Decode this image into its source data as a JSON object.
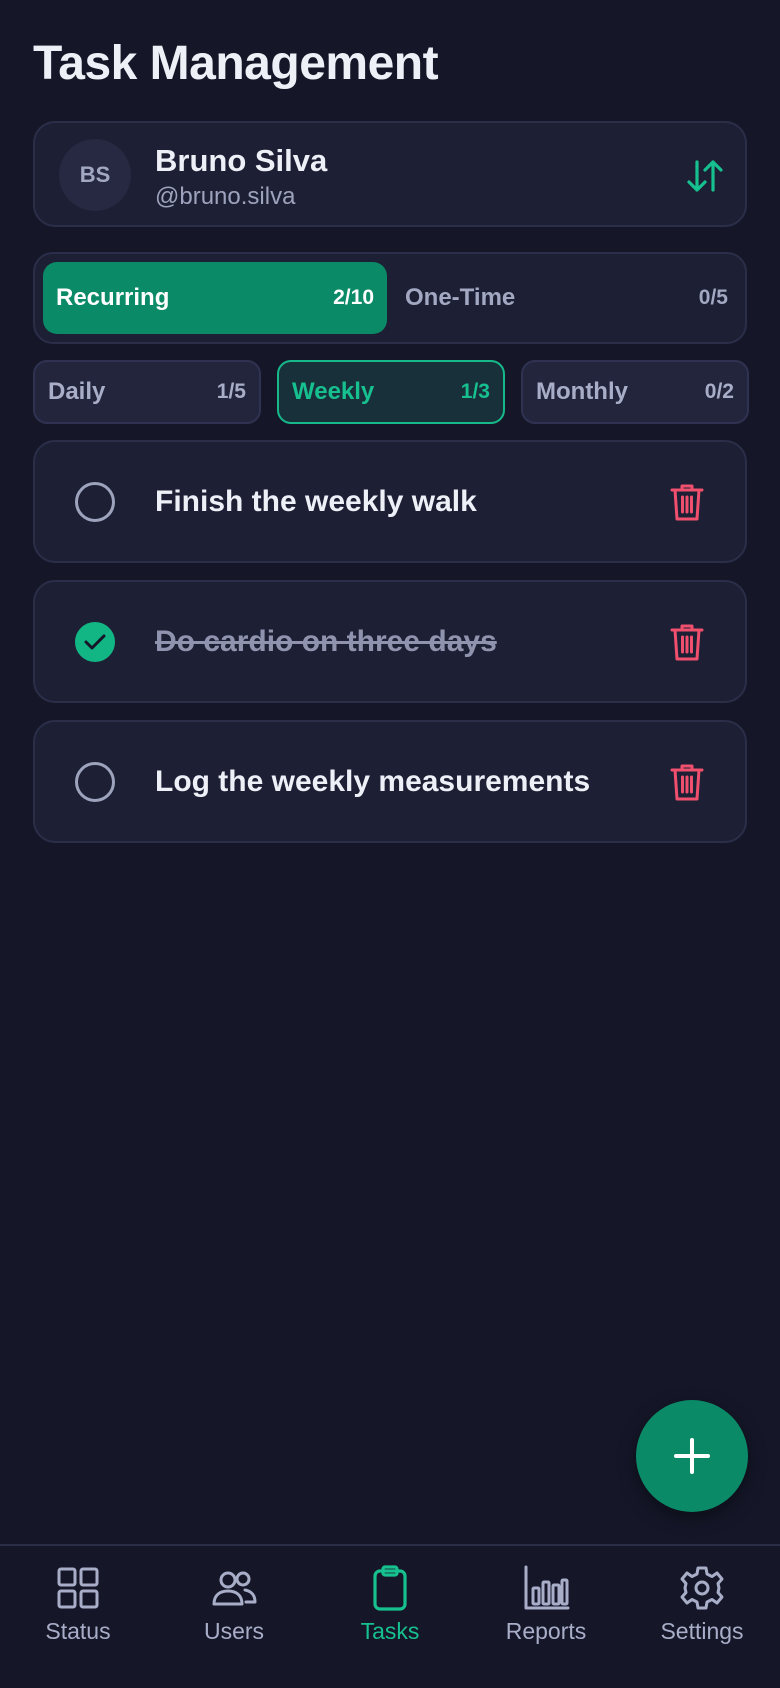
{
  "page": {
    "title": "Task Management"
  },
  "user": {
    "initials": "BS",
    "name": "Bruno Silva",
    "handle": "@bruno.silva",
    "switch_icon": "swap-vertical-icon"
  },
  "segments": [
    {
      "label": "Recurring",
      "count": "2/10",
      "active": true
    },
    {
      "label": "One-Time",
      "count": "0/5",
      "active": false
    }
  ],
  "subtabs": [
    {
      "label": "Daily",
      "count": "1/5",
      "active": false
    },
    {
      "label": "Weekly",
      "count": "1/3",
      "active": true
    },
    {
      "label": "Monthly",
      "count": "0/2",
      "active": false
    }
  ],
  "tasks": [
    {
      "text": "Finish the weekly walk",
      "completed": false
    },
    {
      "text": "Do cardio on three days",
      "completed": true
    },
    {
      "text": "Log the weekly measurements",
      "completed": false
    }
  ],
  "fab": {
    "icon": "plus-icon"
  },
  "nav": [
    {
      "label": "Status",
      "icon": "grid-icon",
      "active": false
    },
    {
      "label": "Users",
      "icon": "users-icon",
      "active": false
    },
    {
      "label": "Tasks",
      "icon": "clipboard-icon",
      "active": true
    },
    {
      "label": "Reports",
      "icon": "bar-chart-icon",
      "active": false
    },
    {
      "label": "Settings",
      "icon": "gear-icon",
      "active": false
    }
  ],
  "colors": {
    "background": "#151729",
    "card": "#1d1f34",
    "accent": "#0a8a66",
    "accent_text": "#17c08f",
    "delete": "#f0506e",
    "muted_text": "#a9aec8"
  }
}
